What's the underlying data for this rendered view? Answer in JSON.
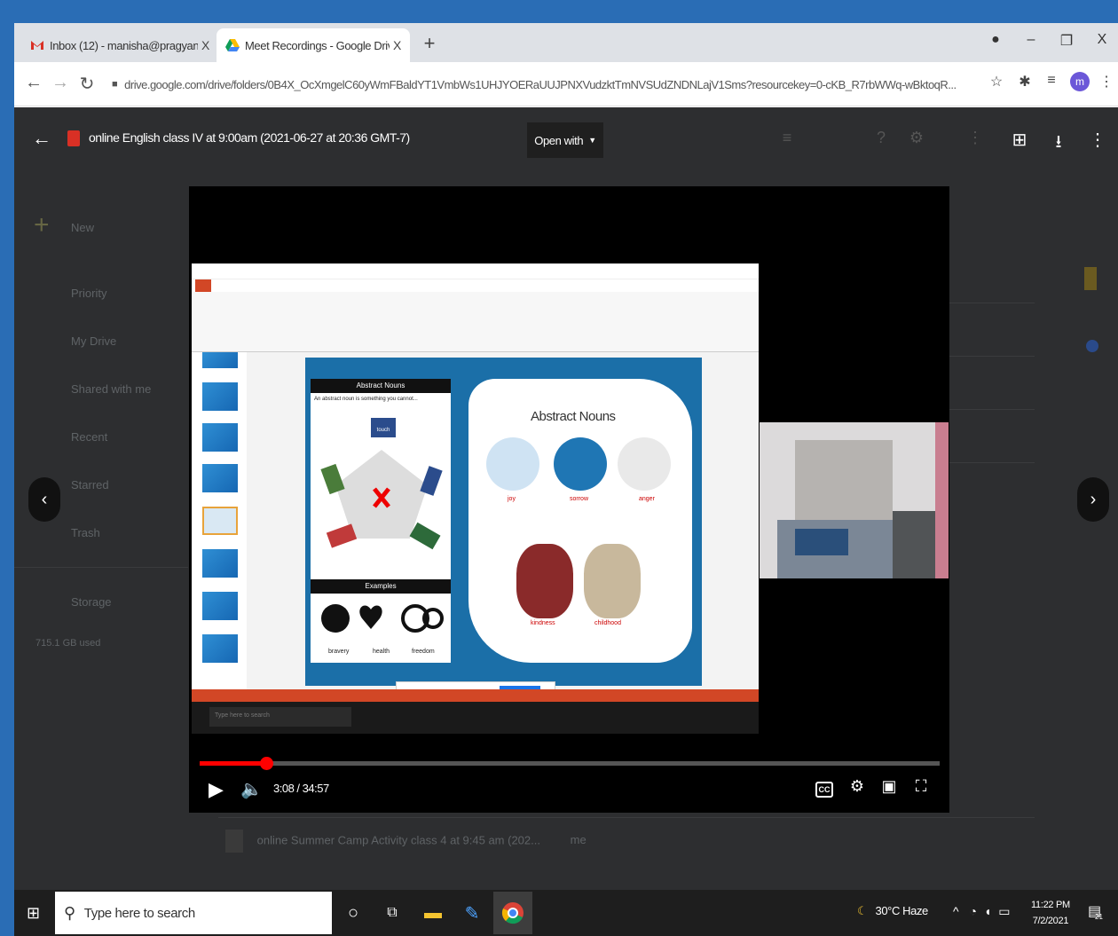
{
  "browser": {
    "tabs": [
      {
        "title": "Inbox (12) - manisha@pragyans",
        "close": "X"
      },
      {
        "title": "Meet Recordings - Google Drive",
        "close": "X"
      }
    ],
    "new_tab": "+",
    "window_controls": {
      "minimize": "–",
      "maximize": "❐",
      "close": "X"
    },
    "url": "drive.google.com/drive/folders/0B4X_OcXmgelC60yWmFBaldYT1VmbWs1UHJYOERaUUJPNXVudzktTmNVSUdZNDNLajV1Sms?resourcekey=0-cKB_R7rbWWq-wBktoqR...",
    "profile_initial": "m"
  },
  "preview": {
    "file_title": "online English class IV at 9:00am (2021-06-27 at 20:36 GMT-7)",
    "open_with": "Open with"
  },
  "drive_bg": {
    "new_label": "New",
    "sidebar": [
      "Priority",
      "My Drive",
      "Shared with me",
      "Recent",
      "Starred",
      "Trash",
      "Storage"
    ],
    "storage_used": "715.1 GB used",
    "row_title": "online Summer Camp Activity class 4 at 9:45 am (202...",
    "row_owner": "me"
  },
  "slide": {
    "abstract_nouns_header": "Abstract Nouns",
    "definition": "An abstract noun is something you cannot...",
    "touch": "touch",
    "examples_header": "Examples",
    "examples": [
      "bravery",
      "health",
      "freedom"
    ],
    "title": "Abstract Nouns",
    "items": [
      "joy",
      "sorrow",
      "anger",
      "kindness",
      "childhood"
    ],
    "inner_search": "Type here to search"
  },
  "player": {
    "time": "3:08 / 34:57",
    "progress_fraction": 0.0898,
    "cc_label": "CC"
  },
  "taskbar": {
    "search_placeholder": "Type here to search",
    "weather": "30°C  Haze",
    "time": "11:22 PM",
    "date": "7/2/2021",
    "notification_count": "21"
  }
}
